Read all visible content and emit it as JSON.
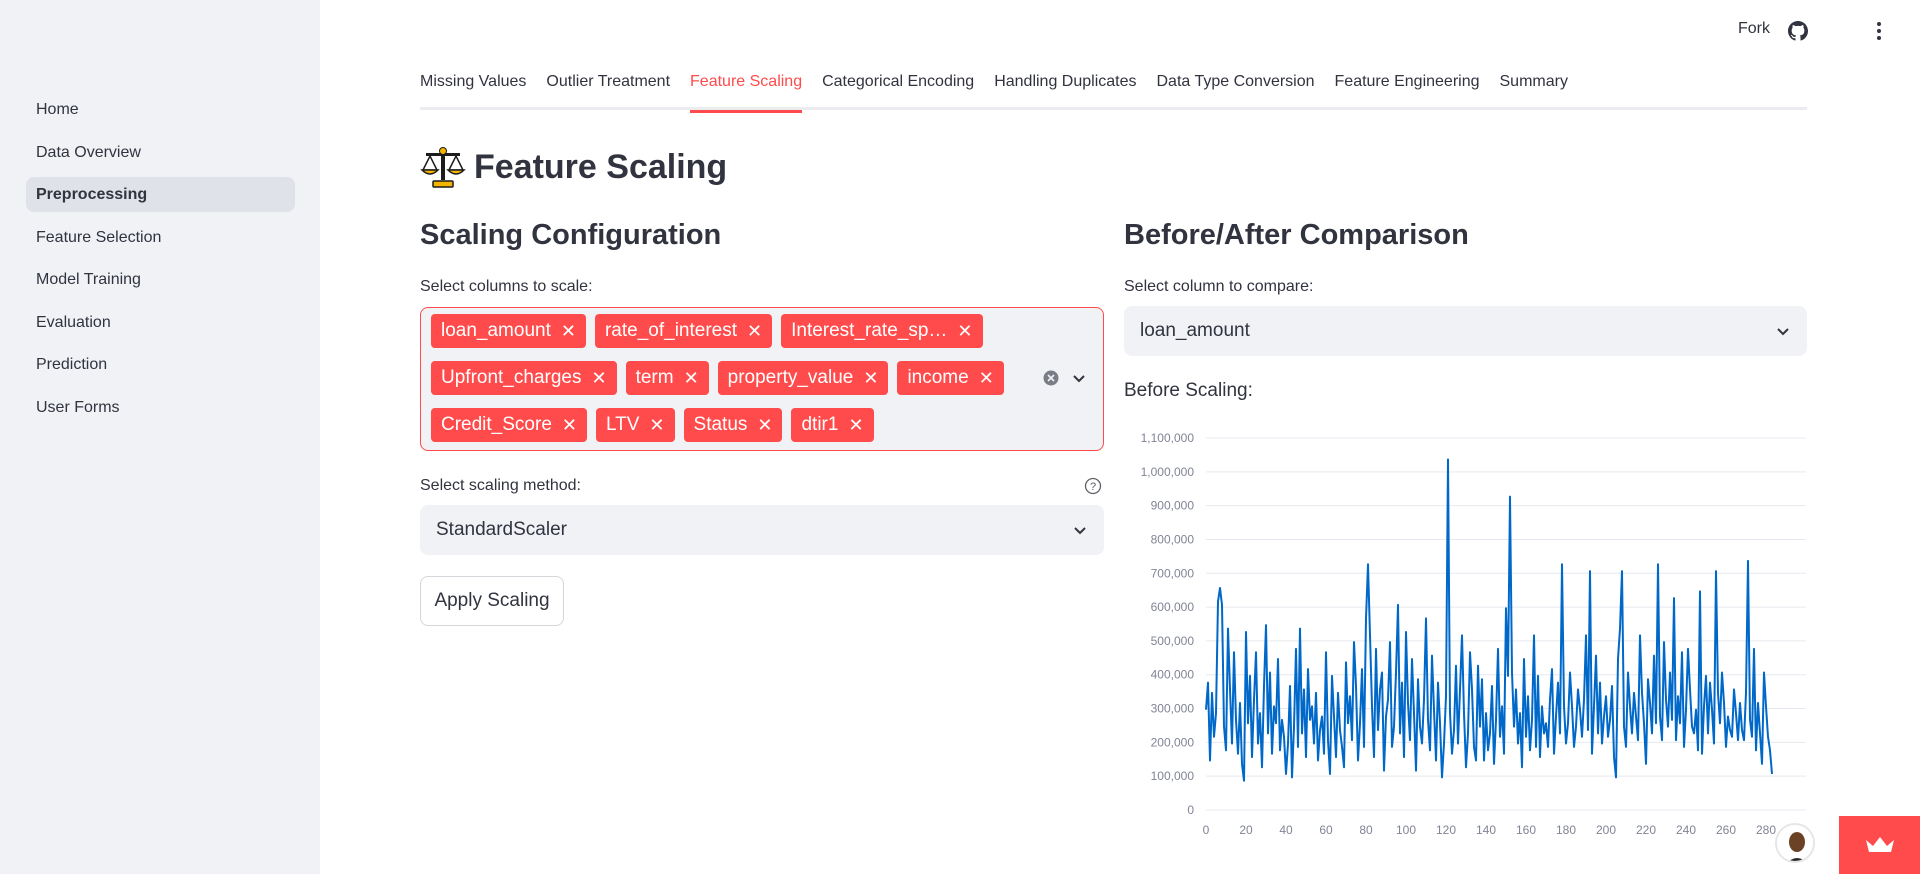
{
  "sidebar": {
    "items": [
      {
        "label": "Home"
      },
      {
        "label": "Data Overview"
      },
      {
        "label": "Preprocessing",
        "active": true
      },
      {
        "label": "Feature Selection"
      },
      {
        "label": "Model Training"
      },
      {
        "label": "Evaluation"
      },
      {
        "label": "Prediction"
      },
      {
        "label": "User Forms"
      }
    ]
  },
  "header": {
    "fork_label": "Fork",
    "github_icon": "github-icon",
    "menu_icon": "kebab-menu-icon"
  },
  "tabs": [
    {
      "label": "Missing Values"
    },
    {
      "label": "Outlier Treatment"
    },
    {
      "label": "Feature Scaling",
      "active": true
    },
    {
      "label": "Categorical Encoding"
    },
    {
      "label": "Handling Duplicates"
    },
    {
      "label": "Data Type Conversion"
    },
    {
      "label": "Feature Engineering"
    },
    {
      "label": "Summary"
    }
  ],
  "page": {
    "title": "Feature Scaling",
    "title_icon": "balance-scale-icon"
  },
  "config": {
    "heading": "Scaling Configuration",
    "columns_label": "Select columns to scale:",
    "tags": [
      "loan_amount",
      "rate_of_interest",
      "Interest_rate_sp…",
      "Upfront_charges",
      "term",
      "property_value",
      "income",
      "Credit_Score",
      "LTV",
      "Status",
      "dtir1"
    ],
    "method_label": "Select scaling method:",
    "method_value": "StandardScaler",
    "apply_label": "Apply Scaling"
  },
  "comparison": {
    "heading": "Before/After Comparison",
    "column_label": "Select column to compare:",
    "column_value": "loan_amount",
    "before_label": "Before Scaling:"
  },
  "colors": {
    "accent": "#ff4b4b",
    "line": "#0068c9",
    "sidebar_bg": "#f0f2f6"
  },
  "chart_data": {
    "type": "line",
    "title": "",
    "xlabel": "",
    "ylabel": "",
    "xlim": [
      0,
      300
    ],
    "ylim": [
      0,
      1100000
    ],
    "xticks": [
      0,
      20,
      40,
      60,
      80,
      100,
      120,
      140,
      160,
      180,
      200,
      220,
      240,
      260,
      280
    ],
    "yticks": [
      0,
      100000,
      200000,
      300000,
      400000,
      500000,
      600000,
      700000,
      800000,
      900000,
      1000000,
      1100000
    ],
    "ytick_labels": [
      "0",
      "100,000",
      "200,000",
      "300,000",
      "400,000",
      "500,000",
      "600,000",
      "700,000",
      "800,000",
      "900,000",
      "1,000,000",
      "1,100,000"
    ],
    "grid": "horizontal",
    "series": [
      {
        "values": [
          296500,
          376500,
          146500,
          346500,
          216500,
          286500,
          616500,
          656500,
          606500,
          246500,
          176500,
          536500,
          356500,
          196500,
          466500,
          266500,
          166500,
          316500,
          136500,
          86500,
          526500,
          256500,
          396500,
          156500,
          326500,
          466500,
          196500,
          286500,
          126500,
          366500,
          546500,
          226500,
          406500,
          166500,
          306500,
          256500,
          446500,
          176500,
          266500,
          216500,
          106500,
          196500,
          366500,
          96500,
          246500,
          476500,
          186500,
          536500,
          226500,
          356500,
          156500,
          416500,
          266500,
          306500,
          196500,
          346500,
          146500,
          236500,
          276500,
          166500,
          466500,
          206500,
          106500,
          396500,
          276500,
          156500,
          346500,
          236500,
          186500,
          126500,
          436500,
          256500,
          336500,
          206500,
          496500,
          366500,
          146500,
          256500,
          416500,
          186500,
          566500,
          726500,
          516500,
          306500,
          156500,
          476500,
          236500,
          356500,
          406500,
          116500,
          276500,
          326500,
          496500,
          186500,
          246500,
          406500,
          606500,
          226500,
          376500,
          156500,
          526500,
          316500,
          206500,
          446500,
          286500,
          116500,
          386500,
          246500,
          196500,
          326500,
          566500,
          266500,
          176500,
          456500,
          296500,
          146500,
          376500,
          256500,
          96500,
          196500,
          336500,
          1036500,
          286500,
          166500,
          236500,
          426500,
          196500,
          356500,
          516500,
          286500,
          126500,
          226500,
          466500,
          356500,
          186500,
          146500,
          426500,
          246500,
          386500,
          146500,
          286500,
          176500,
          226500,
          366500,
          136500,
          266500,
          476500,
          216500,
          306500,
          166500,
          596500,
          396500,
          926500,
          406500,
          246500,
          356500,
          196500,
          286500,
          126500,
          446500,
          216500,
          336500,
          176500,
          266500,
          516500,
          186500,
          396500,
          156500,
          306500,
          226500,
          256500,
          186500,
          326500,
          416500,
          166500,
          276500,
          376500,
          226500,
          726500,
          306500,
          196500,
          256500,
          406500,
          306500,
          186500,
          246500,
          356500,
          296500,
          216500,
          326500,
          516500,
          236500,
          706500,
          166500,
          306500,
          456500,
          226500,
          376500,
          196500,
          276500,
          336500,
          216500,
          266500,
          366500,
          156500,
          96500,
          446500,
          536500,
          706500,
          246500,
          186500,
          406500,
          306500,
          226500,
          346500,
          276500,
          206500,
          516500,
          346500,
          256500,
          136500,
          386500,
          316500,
          226500,
          456500,
          256500,
          726500,
          276500,
          206500,
          496500,
          326500,
          246500,
          406500,
          266500,
          626500,
          206500,
          336500,
          256500,
          466500,
          186500,
          296500,
          476500,
          356500,
          246500,
          226500,
          296500,
          176500,
          646500,
          166500,
          306500,
          396500,
          226500,
          376500,
          296500,
          196500,
          706500,
          346500,
          256500,
          406500,
          316500,
          186500,
          276500,
          236500,
          216500,
          356500,
          286500,
          206500,
          316500,
          236500,
          206500,
          346500,
          736500,
          266500,
          216500,
          476500,
          176500,
          316500,
          226500,
          136500,
          406500,
          306500,
          216500,
          176500,
          106500
        ]
      }
    ]
  }
}
